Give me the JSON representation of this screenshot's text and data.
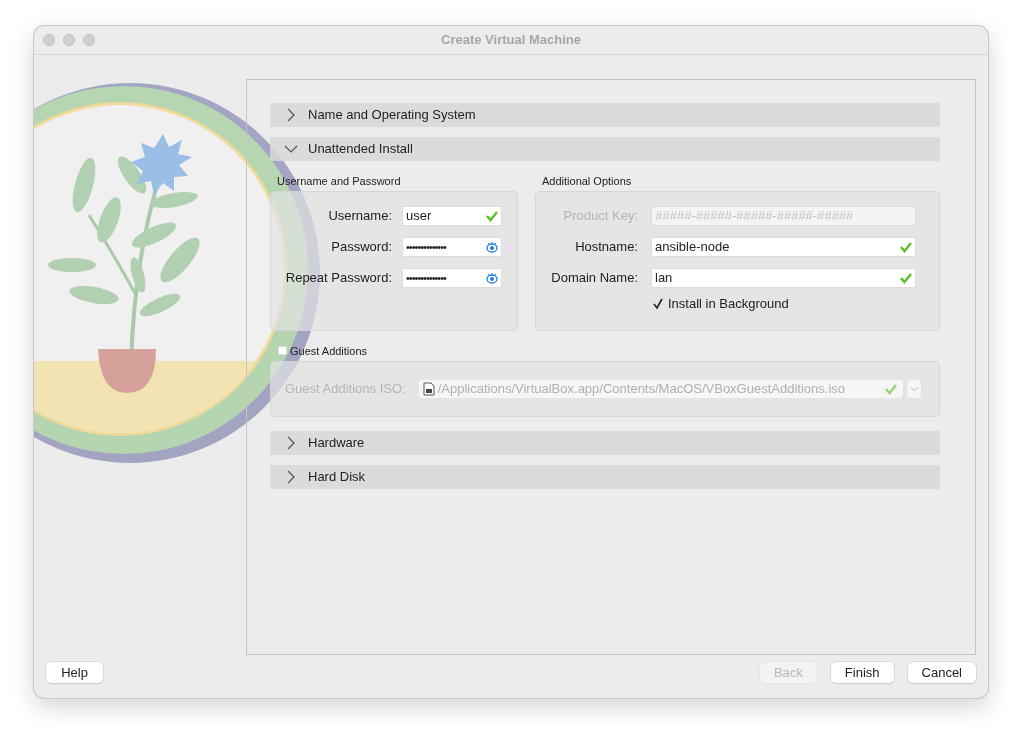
{
  "window": {
    "title": "Create Virtual Machine"
  },
  "sections": [
    {
      "title": "Name and Operating System",
      "expanded": false
    },
    {
      "title": "Unattended Install",
      "expanded": true
    },
    {
      "title": "Hardware",
      "expanded": false
    },
    {
      "title": "Hard Disk",
      "expanded": false
    }
  ],
  "unattended": {
    "credentials": {
      "title": "Username and Password",
      "fields": [
        {
          "label": "Username:",
          "value": "user",
          "kind": "text",
          "valid": true
        },
        {
          "label": "Password:",
          "value": "••••••••••••••",
          "kind": "password"
        },
        {
          "label": "Repeat Password:",
          "value": "••••••••••••••",
          "kind": "password"
        }
      ]
    },
    "options": {
      "title": "Additional Options",
      "fields": [
        {
          "label": "Product Key:",
          "placeholder": "#####-#####-#####-#####-#####",
          "disabled": true
        },
        {
          "label": "Hostname:",
          "value": "ansible-node",
          "disabled": false,
          "valid": true
        },
        {
          "label": "Domain Name:",
          "value": "lan",
          "disabled": false,
          "valid": true
        }
      ],
      "checkbox": {
        "label": "Install in Background",
        "checked": true
      }
    },
    "guest_additions": {
      "label": "Guest Additions",
      "checked": false,
      "iso": {
        "label": "Guest Additions ISO:",
        "value": "/Applications/VirtualBox.app/Contents/MacOS/VBoxGuestAdditions.iso",
        "disabled": true,
        "valid": true
      }
    }
  },
  "buttons_left": [
    {
      "label": "Help",
      "disabled": false
    }
  ],
  "buttons_right": [
    {
      "label": "Back",
      "disabled": true
    },
    {
      "label": "Finish",
      "disabled": false
    },
    {
      "label": "Cancel",
      "disabled": false
    }
  ]
}
